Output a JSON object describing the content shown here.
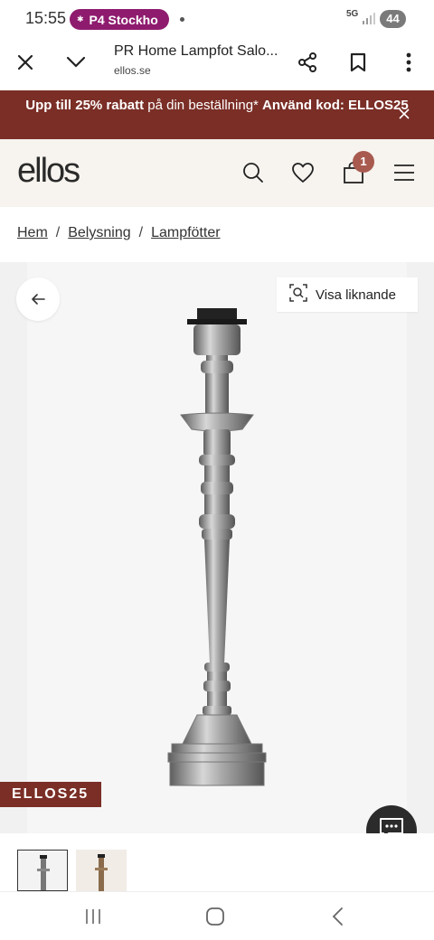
{
  "status_bar": {
    "time": "15:55",
    "media_pill": "P4 Stockho",
    "network": "5G",
    "battery": "44"
  },
  "browser": {
    "page_title": "PR Home Lampfot Salo...",
    "url": "ellos.se",
    "icons": [
      "close-icon",
      "chevron-down-icon",
      "share-icon",
      "bookmark-icon",
      "more-vert-icon"
    ]
  },
  "promo": {
    "bold_start": "Upp till 25% rabatt",
    "middle": " på din beställning* ",
    "bold_end": "Använd kod: ELLOS25"
  },
  "header": {
    "logo": "ellos",
    "cart_count": "1",
    "icons": [
      "search-icon",
      "heart-icon",
      "bag-icon",
      "menu-icon"
    ]
  },
  "breadcrumb": {
    "items": [
      "Hem",
      "Belysning",
      "Lampfötter"
    ],
    "separator": "/"
  },
  "product": {
    "similar_button": "Visa liknande",
    "promo_code_badge": "ELLOS25"
  },
  "colors": {
    "brand_dark_red": "#7a2e26",
    "badge": "#a85a4f",
    "media_pill": "#8e1b6e",
    "header_bg": "#f7f3ee"
  }
}
